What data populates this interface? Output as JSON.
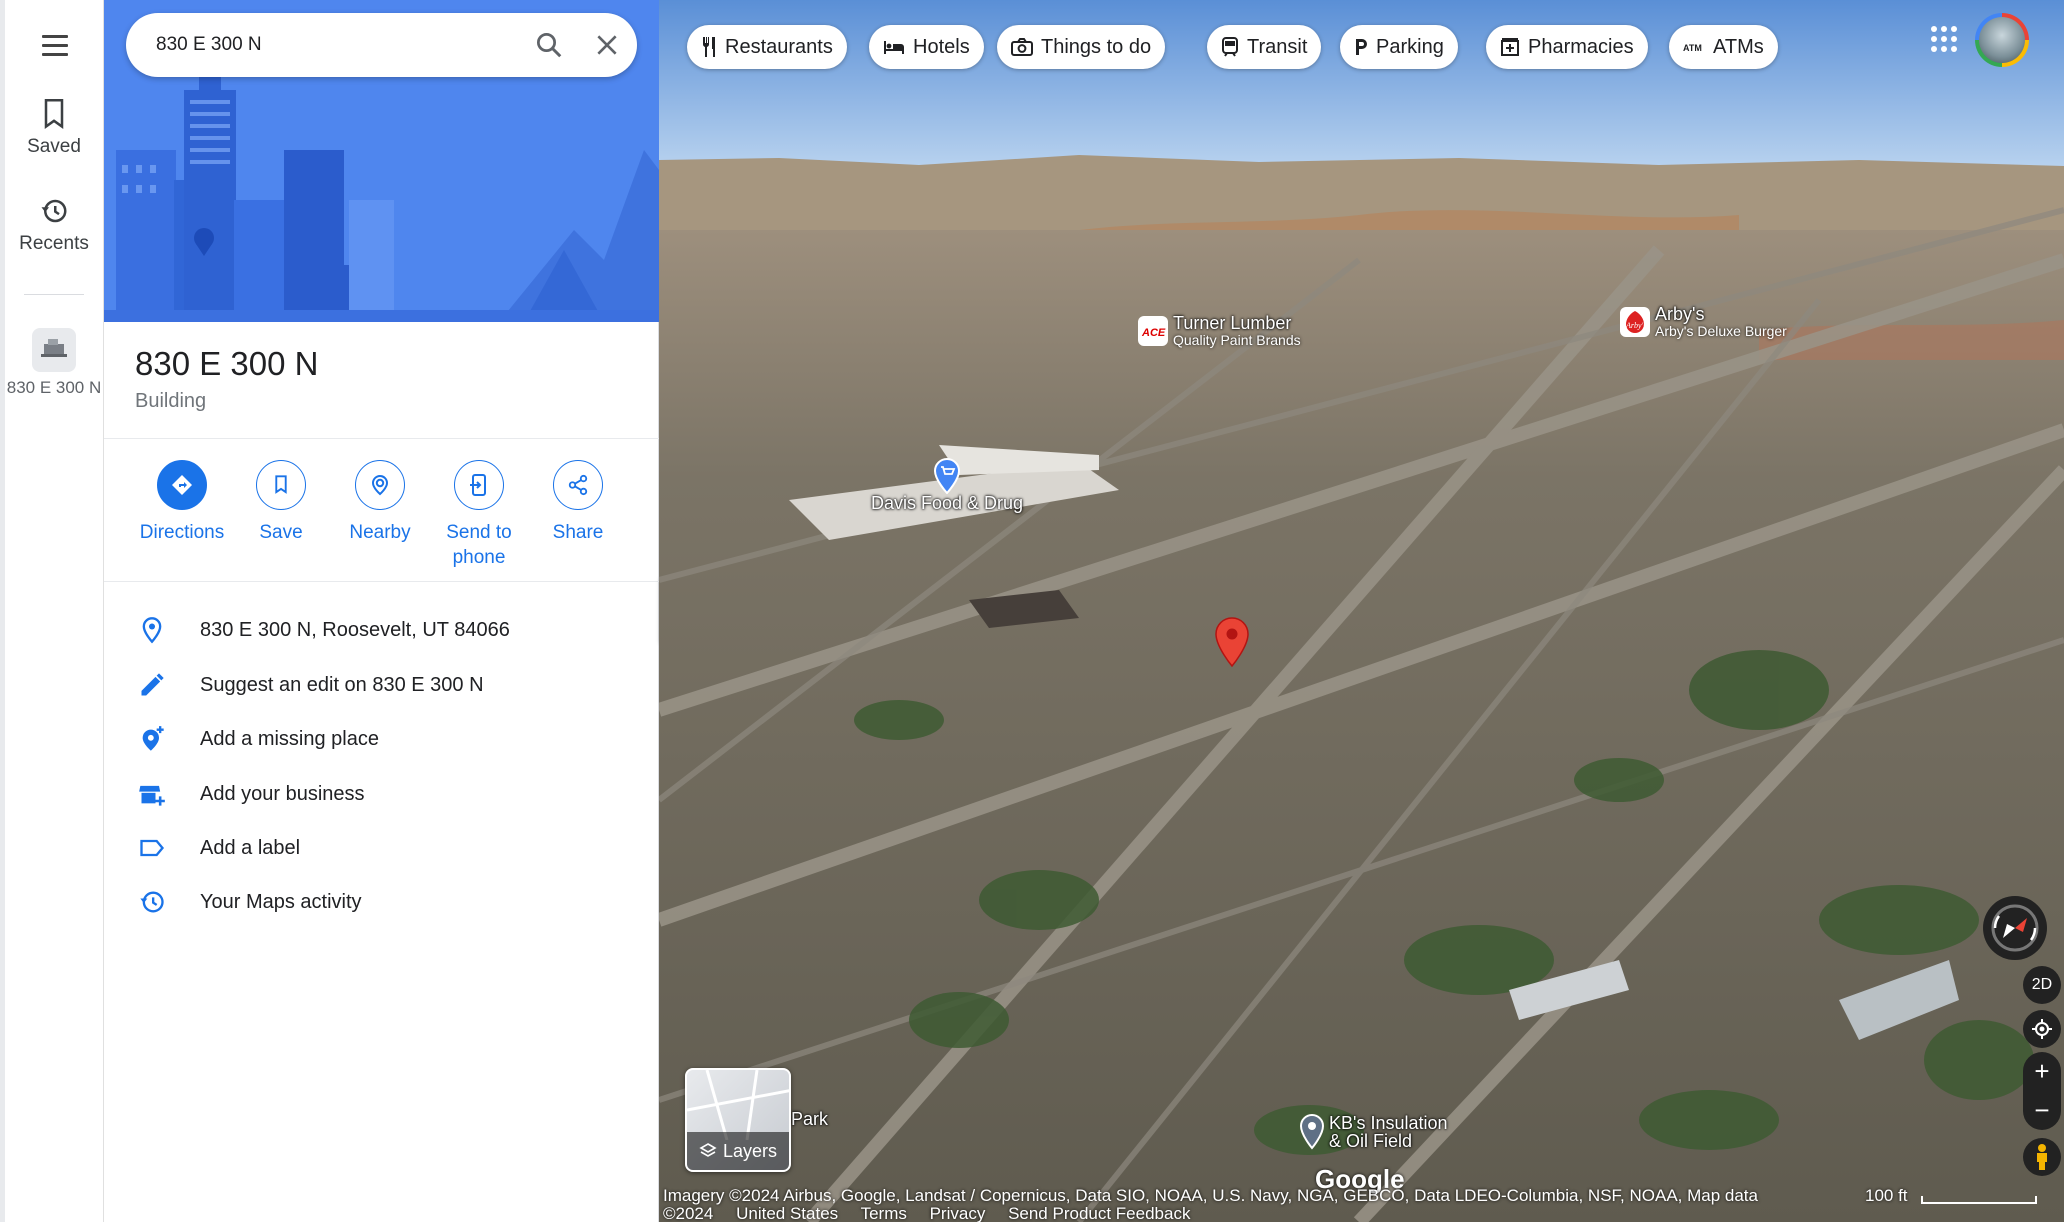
{
  "search": {
    "value": "830 E 300 N"
  },
  "rail": {
    "saved_label": "Saved",
    "recents_label": "Recents",
    "recent_place_label": "830 E 300 N"
  },
  "place": {
    "title": "830 E 300 N",
    "type": "Building"
  },
  "actions": [
    {
      "label": "Directions",
      "icon": "directions-icon"
    },
    {
      "label": "Save",
      "icon": "bookmark-icon"
    },
    {
      "label": "Nearby",
      "icon": "nearby-icon"
    },
    {
      "label": "Send to phone",
      "icon": "send-to-phone-icon"
    },
    {
      "label": "Share",
      "icon": "share-icon"
    }
  ],
  "details": [
    {
      "text": "830 E 300 N, Roosevelt, UT 84066",
      "icon": "location-pin-icon"
    },
    {
      "text": "Suggest an edit on 830 E 300 N",
      "icon": "pencil-icon"
    },
    {
      "text": "Add a missing place",
      "icon": "add-place-icon"
    },
    {
      "text": "Add your business",
      "icon": "add-business-icon"
    },
    {
      "text": "Add a label",
      "icon": "label-icon"
    },
    {
      "text": "Your Maps activity",
      "icon": "history-icon"
    }
  ],
  "chips": [
    {
      "label": "Restaurants",
      "icon": "restaurant-icon"
    },
    {
      "label": "Hotels",
      "icon": "hotel-icon"
    },
    {
      "label": "Things to do",
      "icon": "camera-icon"
    },
    {
      "label": "Transit",
      "icon": "transit-icon"
    },
    {
      "label": "Parking",
      "icon": "parking-icon"
    },
    {
      "label": "Pharmacies",
      "icon": "pharmacy-icon"
    },
    {
      "label": "ATMs",
      "icon": "atm-icon"
    }
  ],
  "pois": {
    "turner": {
      "name": "Turner Lumber",
      "sub": "Quality Paint Brands",
      "logo": "ACE"
    },
    "arbys": {
      "name": "Arby's",
      "sub": "Arby's Deluxe Burger",
      "logo": "Arby's"
    },
    "davis": {
      "name": "Davis Food & Drug"
    },
    "kbs": {
      "name": "KB's Insulation",
      "sub": "& Oil Field"
    },
    "park": {
      "name": "Park"
    }
  },
  "map_controls": {
    "tilt_label": "2D",
    "zoom_in": "+",
    "zoom_out": "−",
    "layers_label": "Layers"
  },
  "footer": {
    "attribution": "Imagery ©2024 Airbus, Google, Landsat / Copernicus, Data SIO, NOAA, U.S. Navy, NGA, GEBCO, Data LDEO-Columbia, NSF, NOAA, Map data",
    "year": "©2024",
    "links": [
      "United States",
      "Terms",
      "Privacy",
      "Send Product Feedback"
    ],
    "scale": "100 ft",
    "watermark": "Google"
  },
  "colors": {
    "accent": "#1a73e8",
    "pin": "#ea4335",
    "hero": "#4a7fe8"
  }
}
